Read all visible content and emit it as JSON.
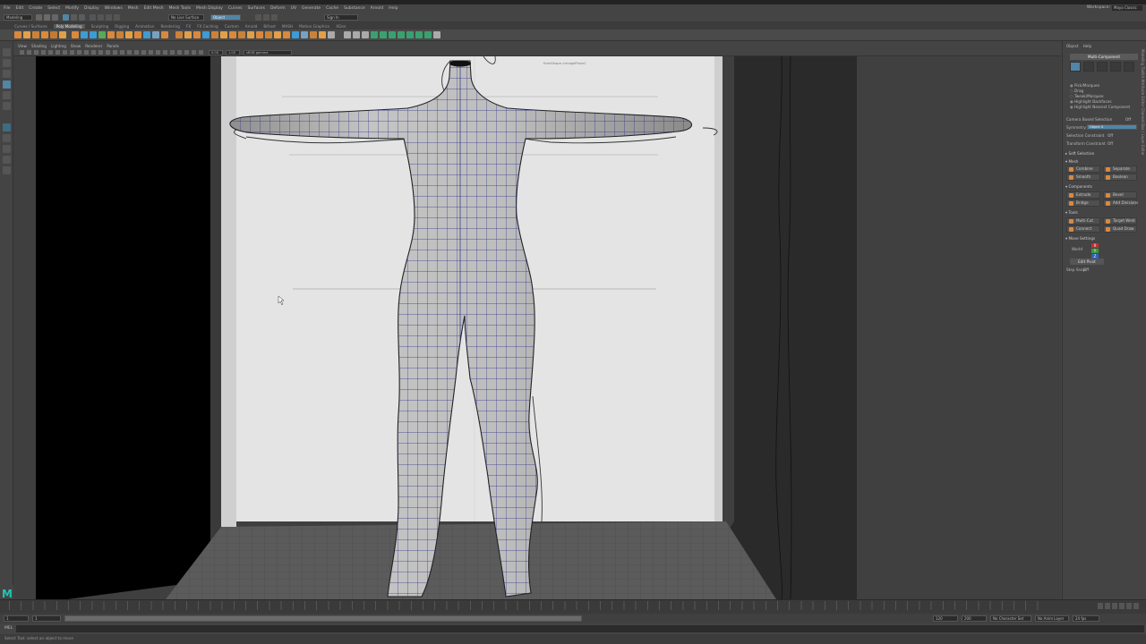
{
  "menubar": {
    "items": [
      "File",
      "Edit",
      "Create",
      "Select",
      "Modify",
      "Display",
      "Windows",
      "Mesh",
      "Edit Mesh",
      "Mesh Tools",
      "Mesh Display",
      "Curves",
      "Surfaces",
      "Deform",
      "UV",
      "Generate",
      "Cache",
      "Substance",
      "Arnold",
      "Help"
    ],
    "workspace_label": "Workspace:",
    "workspace_value": "Maya Classic"
  },
  "statusline": {
    "menuset": "Modeling",
    "live_surface": "No Live Surface",
    "object_field": "Object",
    "sign_in": "Sign In"
  },
  "shelf_tabs": [
    "Curves / Surfaces",
    "Poly Modeling",
    "Sculpting",
    "Rigging",
    "Animation",
    "Rendering",
    "FX",
    "FX Caching",
    "Custom",
    "Arnold",
    "Bifrost",
    "MASH",
    "Motion Graphics",
    "XGen"
  ],
  "shelf_active": "Poly Modeling",
  "panel_menu": [
    "View",
    "Shading",
    "Lighting",
    "Show",
    "Renderer",
    "Panels"
  ],
  "panel_bar": {
    "value_a": "0.00",
    "value_b": "1.00",
    "color_space": "sRGB gamma"
  },
  "modeling_toolkit": {
    "tabs": [
      "Object",
      "Help"
    ],
    "multi_component": "Multi-Component",
    "options": [
      "Pick/Marquee",
      "Drag",
      "Tweak/Marquee",
      "Highlight Backfaces",
      "Highlight Nearest Component"
    ],
    "camera_based_selection": "Camera Based Selection",
    "camera_based_value": "Off",
    "symmetry_label": "Symmetry:",
    "symmetry_value": "Object X",
    "selection_constraint": "Selection Constraint",
    "selection_constraint_value": "Off",
    "transform_constraint": "Transform Constraint",
    "transform_constraint_value": "Off",
    "soft_selection": "Soft Selection",
    "mesh_section": "Mesh",
    "mesh_tools": [
      "Combine",
      "Separate",
      "Smooth",
      "Boolean"
    ],
    "components_section": "Components",
    "component_tools": [
      "Extrude",
      "Bevel",
      "Bridge",
      "Add Divisions"
    ],
    "tools_section": "Tools",
    "tools": [
      "Multi-Cut",
      "Target Weld",
      "Connect",
      "Quad Draw"
    ],
    "move_settings": "Move Settings",
    "world_label": "World",
    "axis_x": "X",
    "axis_y": "Y",
    "axis_z": "Z",
    "edit_pivot": "Edit Pivot",
    "step_snap_label": "Step Snap:",
    "step_snap_value": "Off"
  },
  "side_tabs": "Modeling Toolkit   Attribute Editor   Channel Box / Layer Editor",
  "viewport": {
    "image_plane_label": "frontShape->imagePlane1"
  },
  "time_slider": {
    "range_start": "1",
    "current_frame": "1",
    "range_end_a": "120",
    "range_end_b": "200",
    "no_character_set": "No Character Set",
    "no_anim_layer": "No Anim Layer",
    "fps": "24 fps"
  },
  "command_line": {
    "mel_label": "MEL"
  },
  "help_line": "Select Tool: select an object to move",
  "colors": {
    "accent": "#5285a6",
    "maya_logo": "#24c4b2",
    "wire": "#2b2f8a"
  }
}
